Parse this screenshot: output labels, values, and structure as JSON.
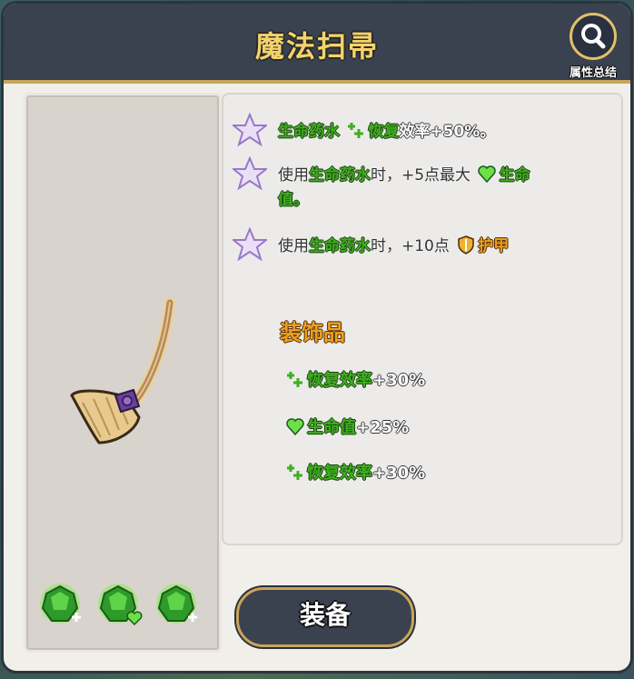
{
  "header": {
    "title": "魔法扫帚"
  },
  "summary_button": {
    "label": "属性总结",
    "icon": "magnifier-icon"
  },
  "item": {
    "icon": "broom-icon",
    "gems": [
      "green-gem-recovery-icon",
      "green-gem-health-icon",
      "green-gem-recovery-icon"
    ]
  },
  "effects": [
    {
      "part1": "生命药水",
      "part2": "恢复",
      "part3": "效率+50%。"
    },
    {
      "part1": "使用",
      "part2": "生命药水",
      "part3": "时，+5点最大",
      "part4": "生命",
      "part5": "值。"
    },
    {
      "part1": "使用",
      "part2": "生命药水",
      "part3": "时，+10点",
      "part4": "护甲"
    }
  ],
  "decorations": {
    "title": "装饰品",
    "items": [
      {
        "label": "恢复效率",
        "value": "+30%"
      },
      {
        "label": "生命值",
        "value": "+25%"
      },
      {
        "label": "恢复效率",
        "value": "+30%"
      }
    ]
  },
  "equip_button": {
    "label": "装备"
  },
  "colors": {
    "header_bg": "#3a4250",
    "title": "#f5d36a",
    "green": "#3eb01f",
    "orange": "#f0a020",
    "gold_border": "#c9a45a"
  }
}
